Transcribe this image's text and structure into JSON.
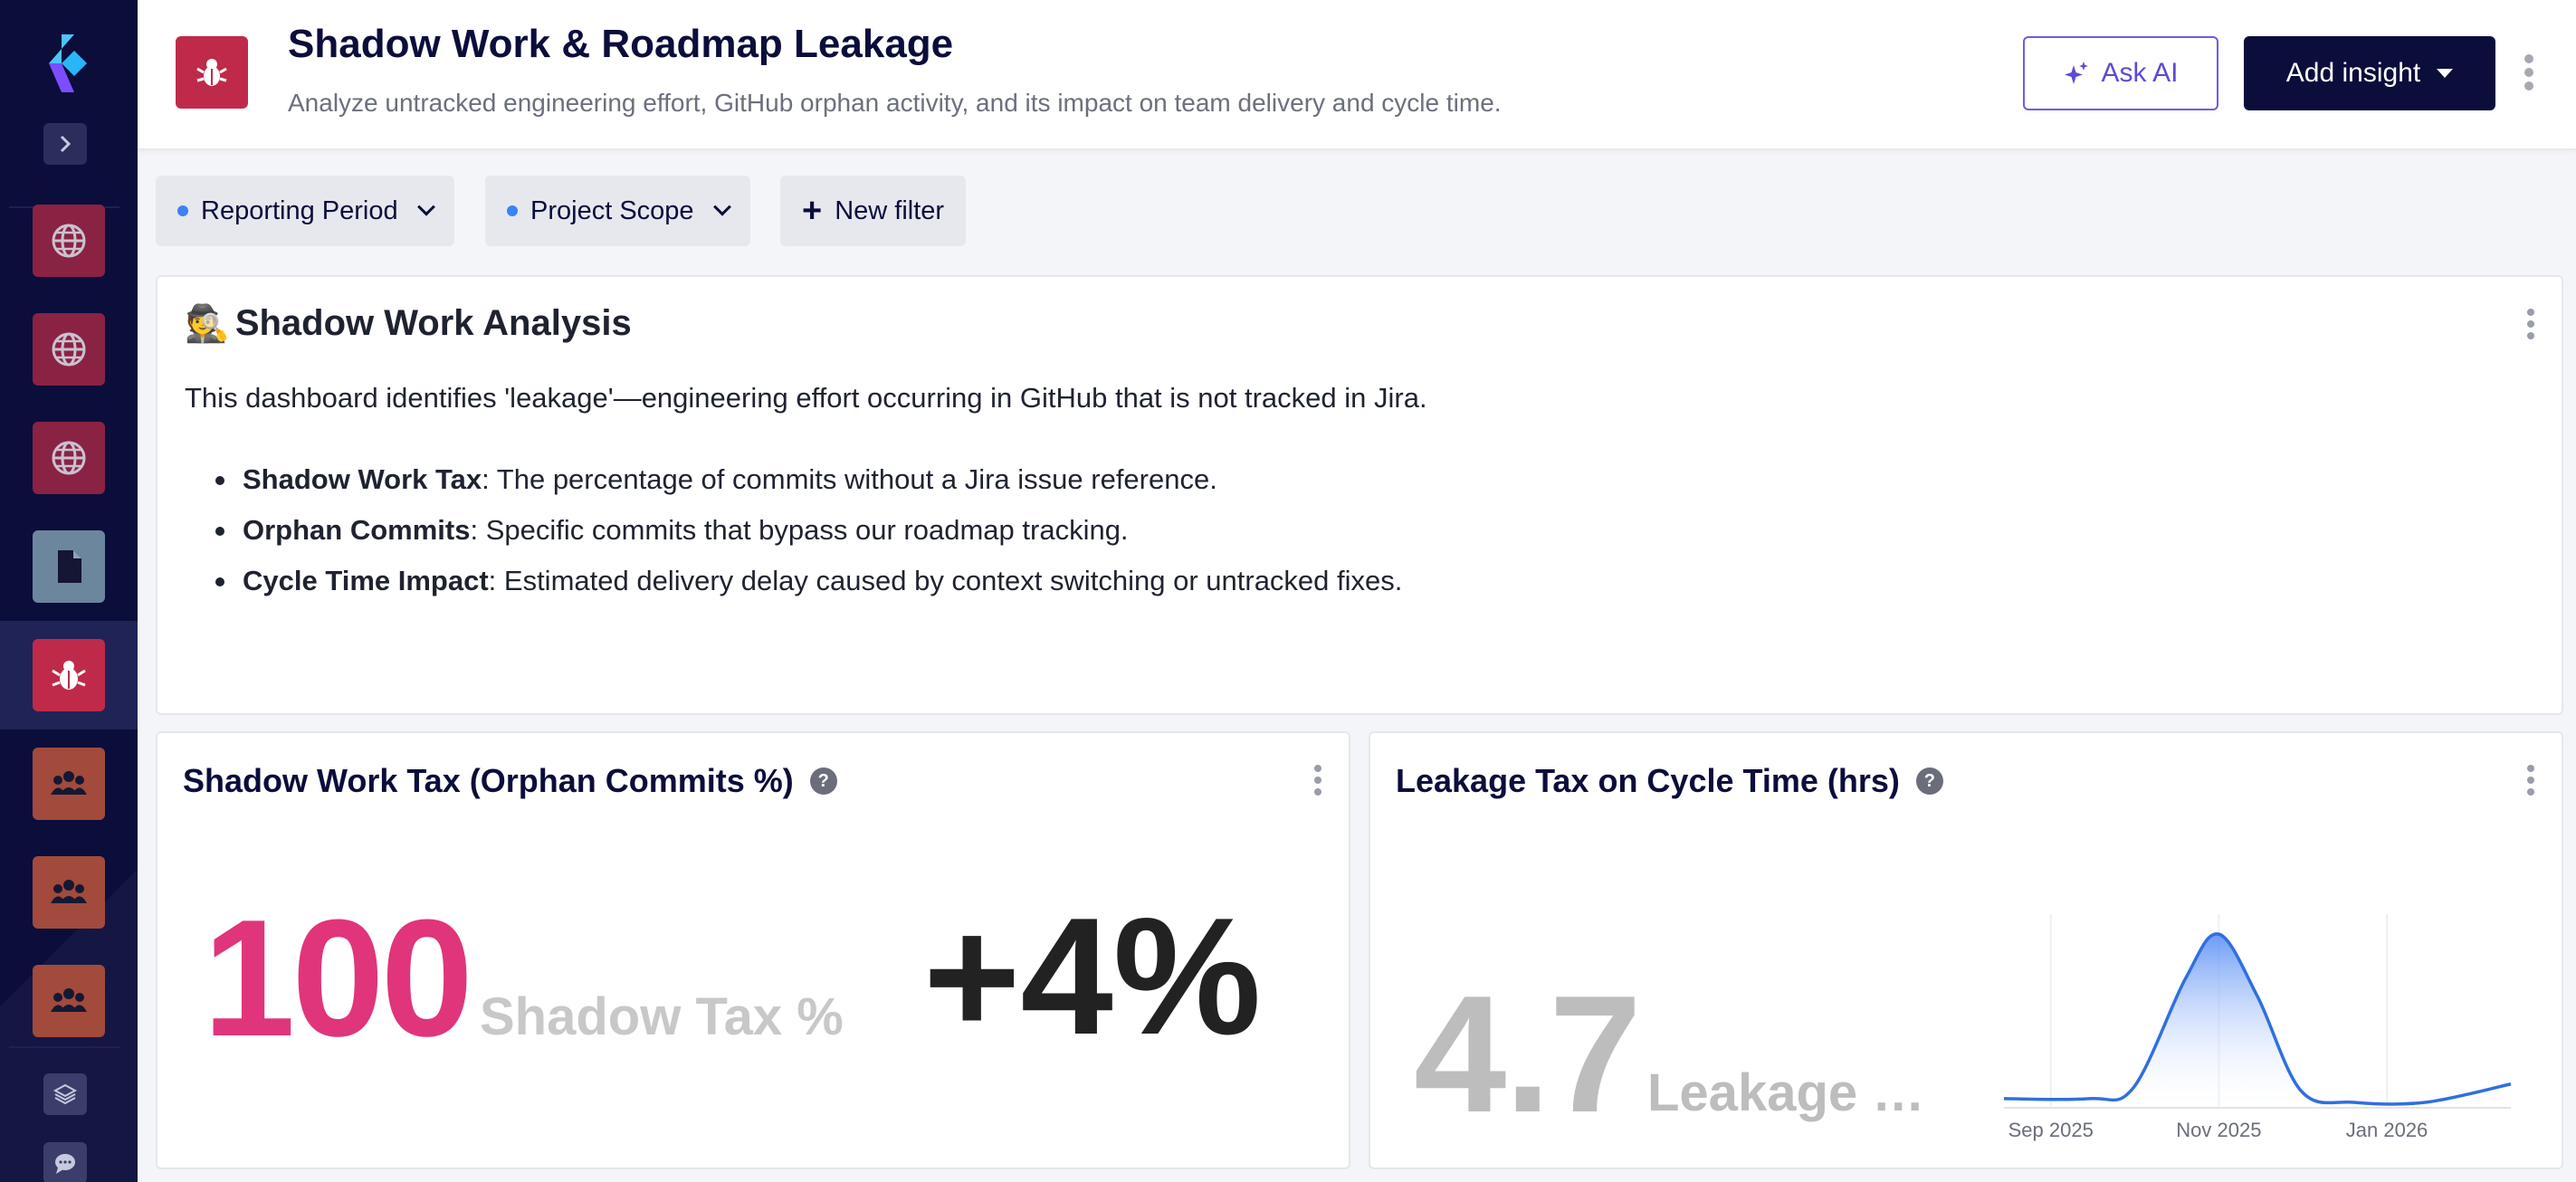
{
  "header": {
    "title": "Shadow Work & Roadmap Leakage",
    "subtitle": "Analyze untracked engineering effort, GitHub orphan activity, and its impact on team delivery and cycle time.",
    "ask_ai_label": "Ask AI",
    "add_insight_label": "Add insight"
  },
  "filters": [
    {
      "label": "Reporting Period"
    },
    {
      "label": "Project Scope"
    },
    {
      "label": "New filter"
    }
  ],
  "sidebar": {
    "items": [
      {
        "icon": "globe-icon",
        "color": "#8a2244"
      },
      {
        "icon": "globe-icon",
        "color": "#8a2244"
      },
      {
        "icon": "globe-icon",
        "color": "#8a2244"
      },
      {
        "icon": "file-icon",
        "color": "#6c869e"
      },
      {
        "icon": "bug-icon",
        "color": "#c02a4a",
        "active": true
      },
      {
        "icon": "users-icon",
        "color": "#a24a3c"
      },
      {
        "icon": "users-icon",
        "color": "#a24a3c"
      },
      {
        "icon": "users-icon",
        "color": "#a24a3c"
      }
    ]
  },
  "text_card": {
    "emoji": "🕵️",
    "heading": "Shadow Work Analysis",
    "intro": "This dashboard identifies 'leakage'—engineering effort occurring in GitHub that is not tracked in Jira.",
    "bullets": [
      {
        "term": "Shadow Work Tax",
        "desc": ": The percentage of commits without a Jira issue reference."
      },
      {
        "term": "Orphan Commits",
        "desc": ": Specific commits that bypass our roadmap tracking."
      },
      {
        "term": "Cycle Time Impact",
        "desc": ": Estimated delivery delay caused by context switching or untracked fixes."
      }
    ]
  },
  "metric_a": {
    "title": "Shadow Work Tax (Orphan Commits %)",
    "value": "100",
    "label": "Shadow Tax %",
    "delta": "+4%"
  },
  "metric_b": {
    "title": "Leakage Tax on Cycle Time (hrs)",
    "value": "4.7",
    "label": "Leakage Delay"
  },
  "chart_data": {
    "type": "area",
    "ticks": [
      "Sep 2025",
      "Nov 2025",
      "Jan 2026"
    ],
    "x": [
      "2025-08-15",
      "2025-09-15",
      "2025-10-01",
      "2025-10-20",
      "2025-11-01",
      "2025-11-15",
      "2025-12-01",
      "2025-12-20",
      "2026-01-15",
      "2026-02-15"
    ],
    "values": [
      0.2,
      0.2,
      0.5,
      3.5,
      4.7,
      3.0,
      0.4,
      0.1,
      0.1,
      0.6
    ],
    "ylim": [
      0,
      5
    ],
    "grid": false,
    "colors": {
      "line": "#2f6fe0",
      "fill_top": "#5b8ff5",
      "fill_bottom": "#ffffff"
    }
  }
}
